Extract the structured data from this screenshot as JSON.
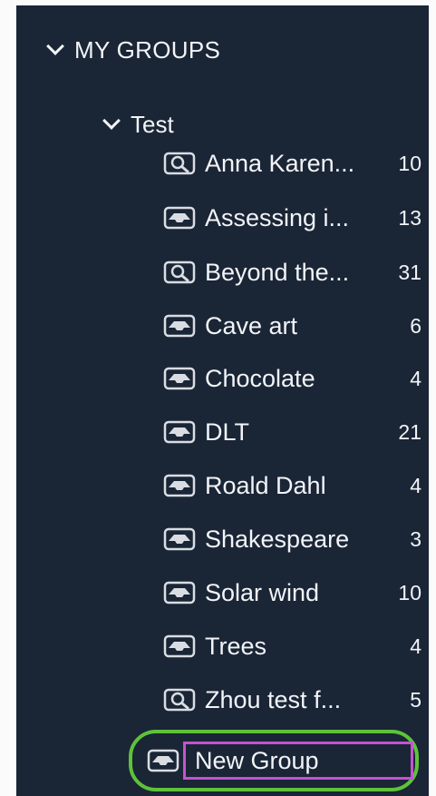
{
  "sidebar": {
    "section_header": "MY GROUPS",
    "group": {
      "label": "Test",
      "items": [
        {
          "label": "Anna Karen...",
          "count": "10",
          "icon": "saved-search-icon"
        },
        {
          "label": "Assessing i...",
          "count": "13",
          "icon": "group-tray-icon"
        },
        {
          "label": "Beyond the...",
          "count": "31",
          "icon": "saved-search-icon"
        },
        {
          "label": "Cave art",
          "count": "6",
          "icon": "group-tray-icon"
        },
        {
          "label": "Chocolate",
          "count": "4",
          "icon": "group-tray-icon"
        },
        {
          "label": "DLT",
          "count": "21",
          "icon": "group-tray-icon"
        },
        {
          "label": "Roald Dahl",
          "count": "4",
          "icon": "group-tray-icon"
        },
        {
          "label": "Shakespeare",
          "count": "3",
          "icon": "group-tray-icon"
        },
        {
          "label": "Solar wind",
          "count": "10",
          "icon": "group-tray-icon"
        },
        {
          "label": "Trees",
          "count": "4",
          "icon": "group-tray-icon"
        },
        {
          "label": "Zhou test f...",
          "count": "5",
          "icon": "saved-search-icon"
        }
      ]
    },
    "new_group": {
      "value": "New Group",
      "icon": "group-tray-icon"
    }
  },
  "colors": {
    "panel_bg": "#1a2536",
    "text": "#f2f4f7",
    "highlight_ring": "#5ec23a",
    "edit_border": "#c453d1"
  }
}
